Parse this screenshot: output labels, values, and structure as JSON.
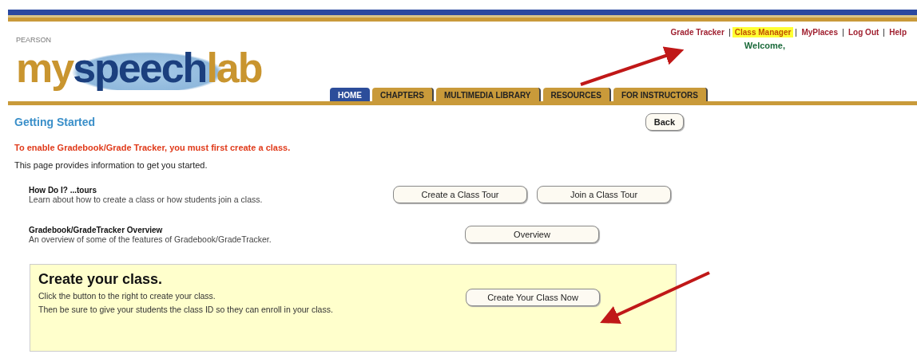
{
  "header": {
    "logo": {
      "brand": "PEARSON",
      "my": "my",
      "speech": "speech",
      "lab": "lab"
    },
    "top_links": [
      {
        "label": "Grade Tracker",
        "highlighted": false
      },
      {
        "label": "Class Manager",
        "highlighted": true
      },
      {
        "label": "MyPlaces",
        "highlighted": false
      },
      {
        "label": "Log Out",
        "highlighted": false
      },
      {
        "label": "Help",
        "highlighted": false
      }
    ],
    "welcome": "Welcome,",
    "tabs": [
      {
        "label": "HOME",
        "selected": true
      },
      {
        "label": "CHAPTERS",
        "selected": false
      },
      {
        "label": "MULTIMEDIA LIBRARY",
        "selected": false
      },
      {
        "label": "RESOURCES",
        "selected": false
      },
      {
        "label": "FOR INSTRUCTORS",
        "selected": false
      }
    ]
  },
  "page": {
    "title": "Getting Started",
    "back_button": "Back",
    "warning": "To enable Gradebook/Grade Tracker, you must first create a class.",
    "intro": "This page provides information to get you started.",
    "sections": [
      {
        "heading": "How Do I? ...tours",
        "description": "Learn about how to create a class or how students join a class.",
        "buttons": [
          "Create a Class Tour",
          "Join a Class Tour"
        ]
      },
      {
        "heading": "Gradebook/GradeTracker Overview",
        "description": "An overview of some of the features of Gradebook/GradeTracker.",
        "buttons": [
          "Overview"
        ]
      }
    ],
    "create_box": {
      "heading": "Create your class.",
      "lines": [
        "Click the button to the right to create your class.",
        "Then be sure to give your students the class ID so they can enroll in your class."
      ],
      "button": "Create Your Class Now"
    }
  }
}
